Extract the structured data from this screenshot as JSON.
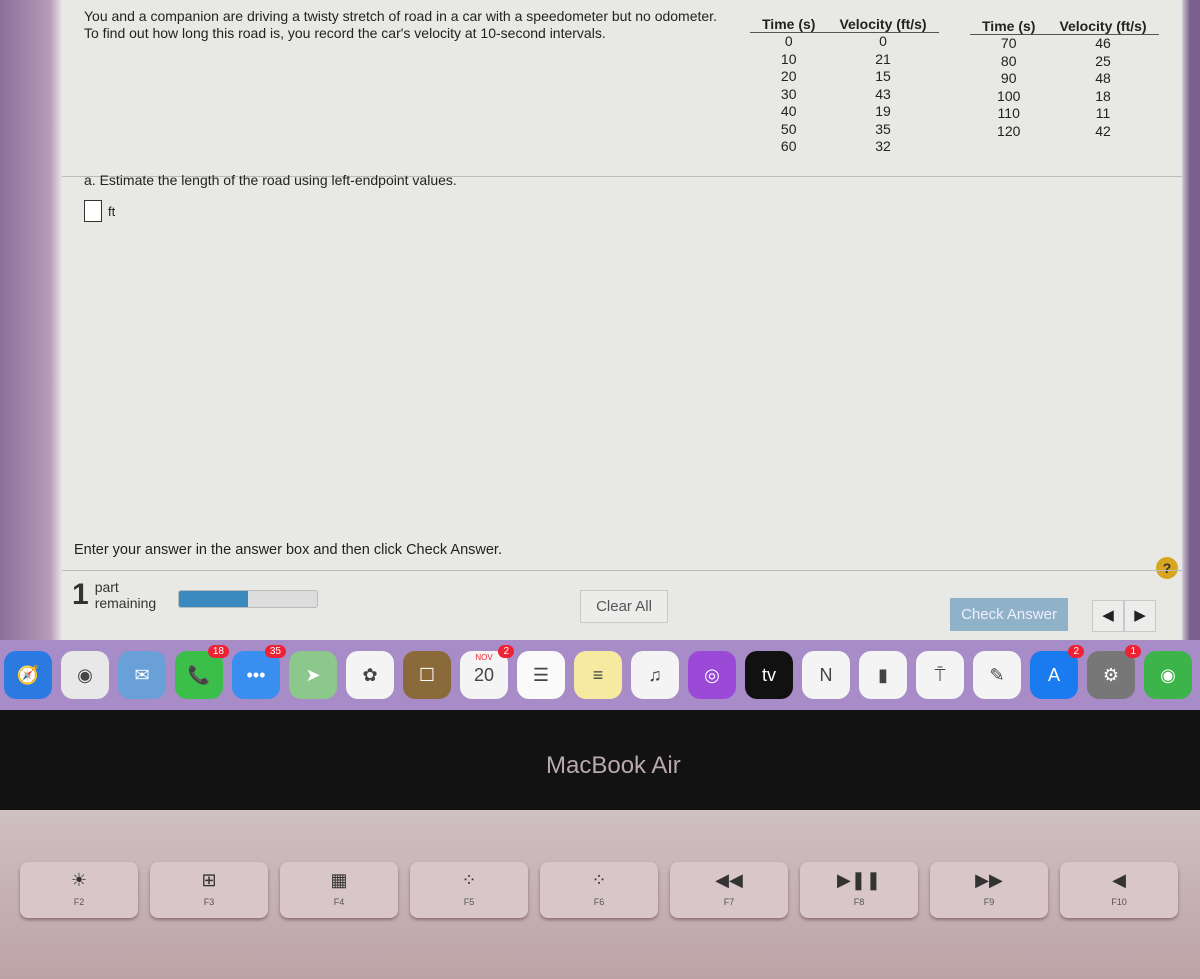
{
  "question": "You and a companion are driving a twisty stretch of road in a car with a speedometer but no odometer. To find out how long this road is, you record the car's velocity at 10-second intervals.",
  "table": {
    "headers": [
      "Time (s)",
      "Velocity (ft/s)"
    ],
    "left": [
      [
        "0",
        "0"
      ],
      [
        "10",
        "21"
      ],
      [
        "20",
        "15"
      ],
      [
        "30",
        "43"
      ],
      [
        "40",
        "19"
      ],
      [
        "50",
        "35"
      ],
      [
        "60",
        "32"
      ]
    ],
    "right": [
      [
        "70",
        "46"
      ],
      [
        "80",
        "25"
      ],
      [
        "90",
        "48"
      ],
      [
        "100",
        "18"
      ],
      [
        "110",
        "11"
      ],
      [
        "120",
        "42"
      ]
    ]
  },
  "part_a": "a. Estimate the length of the road using left-endpoint values.",
  "answer": {
    "value": "",
    "unit": "ft"
  },
  "instruction": "Enter your answer in the answer box and then click Check Answer.",
  "help": "?",
  "progress": {
    "count": "1",
    "label_1": "part",
    "label_2": "remaining",
    "fraction": 0.5,
    "color": "#3a8ac0"
  },
  "buttons": {
    "clear": "Clear All",
    "check": "Check Answer",
    "prev": "◀",
    "next": "▶"
  },
  "dock": [
    {
      "name": "safari",
      "glyph": "🧭",
      "bg": "#2a7ae2"
    },
    {
      "name": "chrome",
      "glyph": "◉",
      "bg": "#e8e8e8"
    },
    {
      "name": "mail",
      "glyph": "✉",
      "bg": "#6aa0d8"
    },
    {
      "name": "facetime",
      "glyph": "📞",
      "bg": "#3cbf4a",
      "badge": "18"
    },
    {
      "name": "messages",
      "glyph": "•••",
      "bg": "#3a8ef0",
      "badge": "35"
    },
    {
      "name": "maps",
      "glyph": "➤",
      "bg": "#8cc88c"
    },
    {
      "name": "photos",
      "glyph": "✿",
      "bg": "#f4f4f4"
    },
    {
      "name": "contacts",
      "glyph": "☐",
      "bg": "#8a6a3a"
    },
    {
      "name": "calendar",
      "glyph": "20",
      "bg": "#f4f4f4",
      "badge": "2",
      "month": "NOV"
    },
    {
      "name": "reminders",
      "glyph": "☰",
      "bg": "#fafafa"
    },
    {
      "name": "notes",
      "glyph": "≡",
      "bg": "#f6e9a0"
    },
    {
      "name": "music",
      "glyph": "♫",
      "bg": "#f4f4f4"
    },
    {
      "name": "podcasts",
      "glyph": "◎",
      "bg": "#9b4ad8"
    },
    {
      "name": "apple-tv",
      "glyph": "tv",
      "bg": "#111"
    },
    {
      "name": "news",
      "glyph": "N",
      "bg": "#f4f4f4"
    },
    {
      "name": "numbers",
      "glyph": "▮",
      "bg": "#f4f4f4"
    },
    {
      "name": "keynote",
      "glyph": "⍑",
      "bg": "#f4f4f4"
    },
    {
      "name": "pages",
      "glyph": "✎",
      "bg": "#f4f4f4"
    },
    {
      "name": "app-store",
      "glyph": "A",
      "bg": "#1a7af0",
      "badge": "2"
    },
    {
      "name": "system-preferences",
      "glyph": "⚙",
      "bg": "#777",
      "badge": "1"
    },
    {
      "name": "find-my",
      "glyph": "◉",
      "bg": "#3cb44a"
    }
  ],
  "device_label": "MacBook Air",
  "keys": [
    {
      "glyph": "☀",
      "label": "F2"
    },
    {
      "glyph": "⊞",
      "label": "F3"
    },
    {
      "glyph": "▦",
      "label": "F4"
    },
    {
      "glyph": "⁘",
      "label": "F5"
    },
    {
      "glyph": "⁘",
      "label": "F6"
    },
    {
      "glyph": "◀◀",
      "label": "F7"
    },
    {
      "glyph": "▶❚❚",
      "label": "F8"
    },
    {
      "glyph": "▶▶",
      "label": "F9"
    },
    {
      "glyph": "◀",
      "label": "F10"
    }
  ]
}
